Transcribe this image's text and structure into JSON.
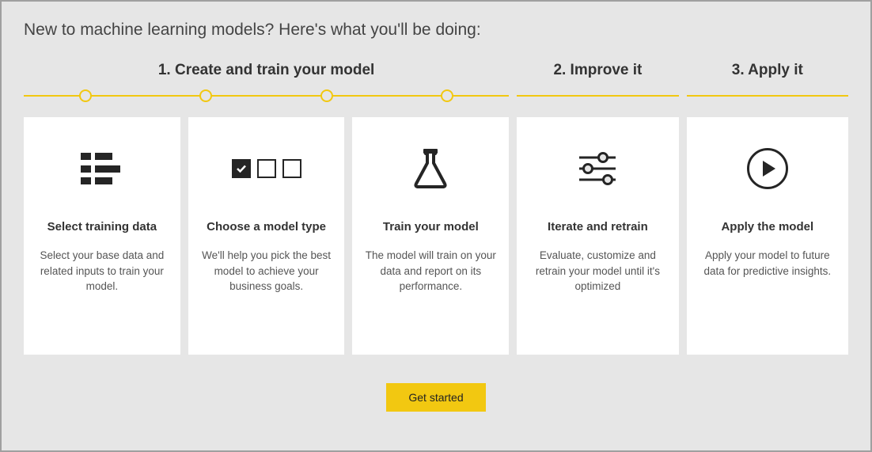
{
  "intro": "New to machine learning models? Here's what you'll be doing:",
  "steps": {
    "group1": {
      "label": "1. Create and train your model"
    },
    "group2": {
      "label": "2. Improve it"
    },
    "group3": {
      "label": "3. Apply it"
    }
  },
  "cards": {
    "select_training": {
      "title": "Select training data",
      "desc": "Select your base data and related inputs to train your model."
    },
    "choose_model": {
      "title": "Choose a model type",
      "desc": "We'll help you pick the best model to achieve your business goals."
    },
    "train_model": {
      "title": "Train your model",
      "desc": "The model will train on your data and report on its performance."
    },
    "iterate": {
      "title": "Iterate and retrain",
      "desc": "Evaluate, customize and retrain your model until it's optimized"
    },
    "apply": {
      "title": "Apply the model",
      "desc": "Apply your model to future data for predictive insights."
    }
  },
  "button": {
    "get_started": "Get started"
  }
}
